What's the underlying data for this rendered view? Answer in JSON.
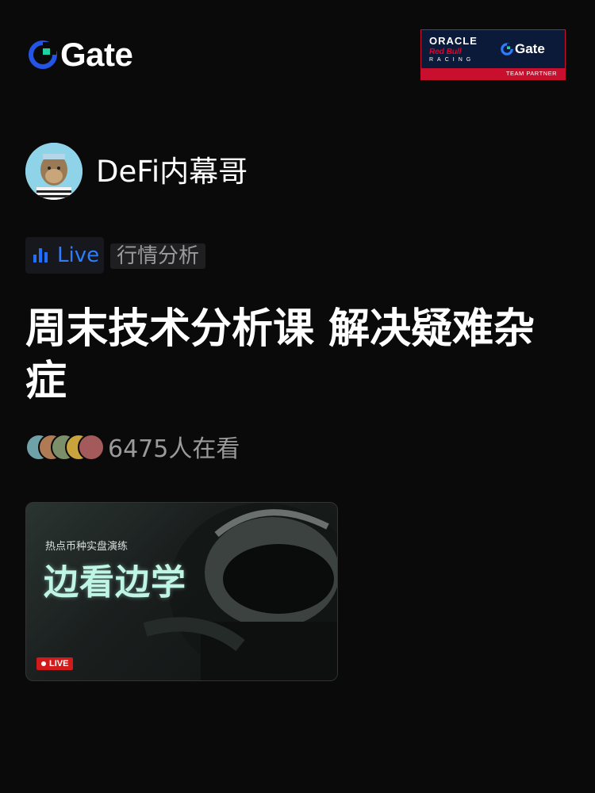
{
  "header": {
    "brand": "Gate",
    "partner": {
      "oracle": "ORACLE",
      "redbull": "Red Bull",
      "racing": "RACING",
      "brand": "Gate",
      "footer": "TEAM PARTNER"
    }
  },
  "author": {
    "name": "DeFi内幕哥"
  },
  "tags": {
    "live": "Live",
    "category": "行情分析"
  },
  "stream": {
    "title": "周末技术分析课 解决疑难杂症",
    "viewers": "6475人在看"
  },
  "video": {
    "subtitle": "热点币种实盘演练",
    "headline": "边看边学",
    "live_badge": "LIVE"
  },
  "colors": {
    "accent_blue": "#2f7dff",
    "live_red": "#d11a1a",
    "background": "#0a0a0a"
  }
}
